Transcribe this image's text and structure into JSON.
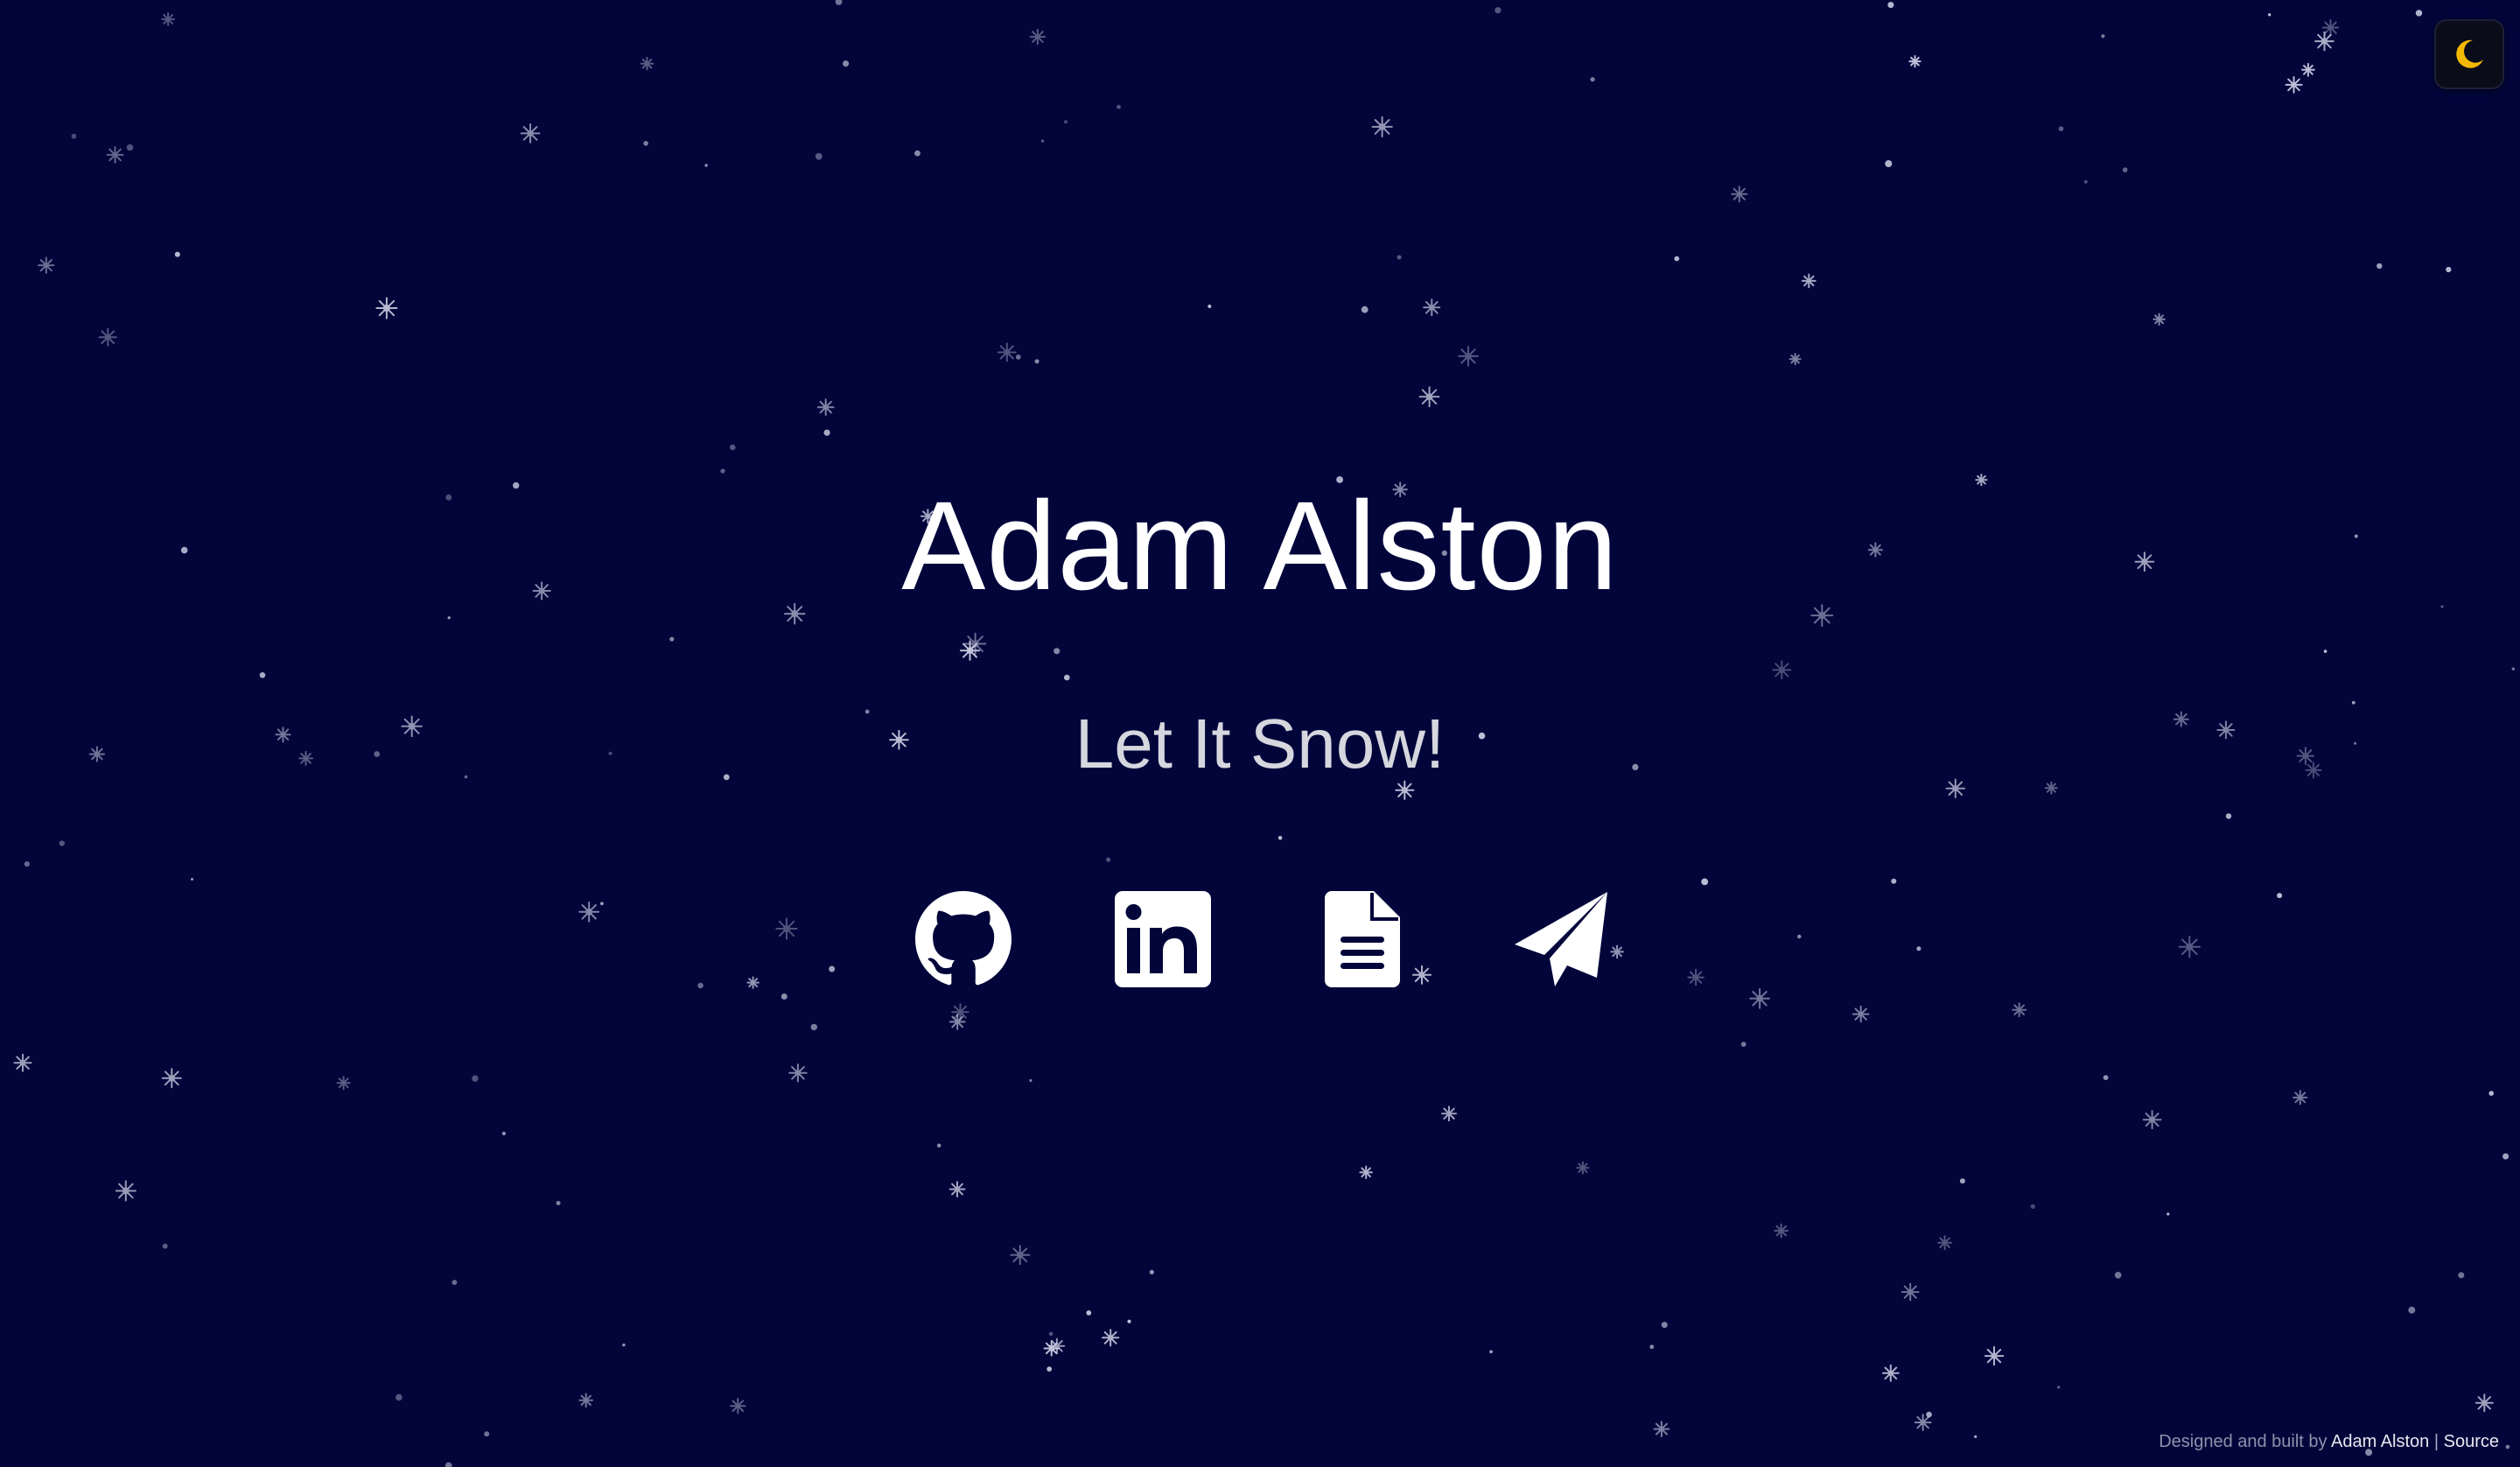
{
  "theme": {
    "background": "#01053a",
    "text_primary": "#ffffff",
    "text_secondary": "#d6d7de",
    "moon_color": "#f5b800",
    "snow_color": "#c9cbe0"
  },
  "theme_toggle": {
    "icon": "crescent-moon-icon"
  },
  "hero": {
    "name": "Adam Alston",
    "tagline": "Let It Snow!"
  },
  "social_links": [
    {
      "icon": "github-icon"
    },
    {
      "icon": "linkedin-icon"
    },
    {
      "icon": "resume-document-icon"
    },
    {
      "icon": "paper-plane-icon"
    }
  ],
  "footer": {
    "prefix": "Designed and built by",
    "author": "Adam Alston",
    "separator": "|",
    "source_label": "Source"
  }
}
